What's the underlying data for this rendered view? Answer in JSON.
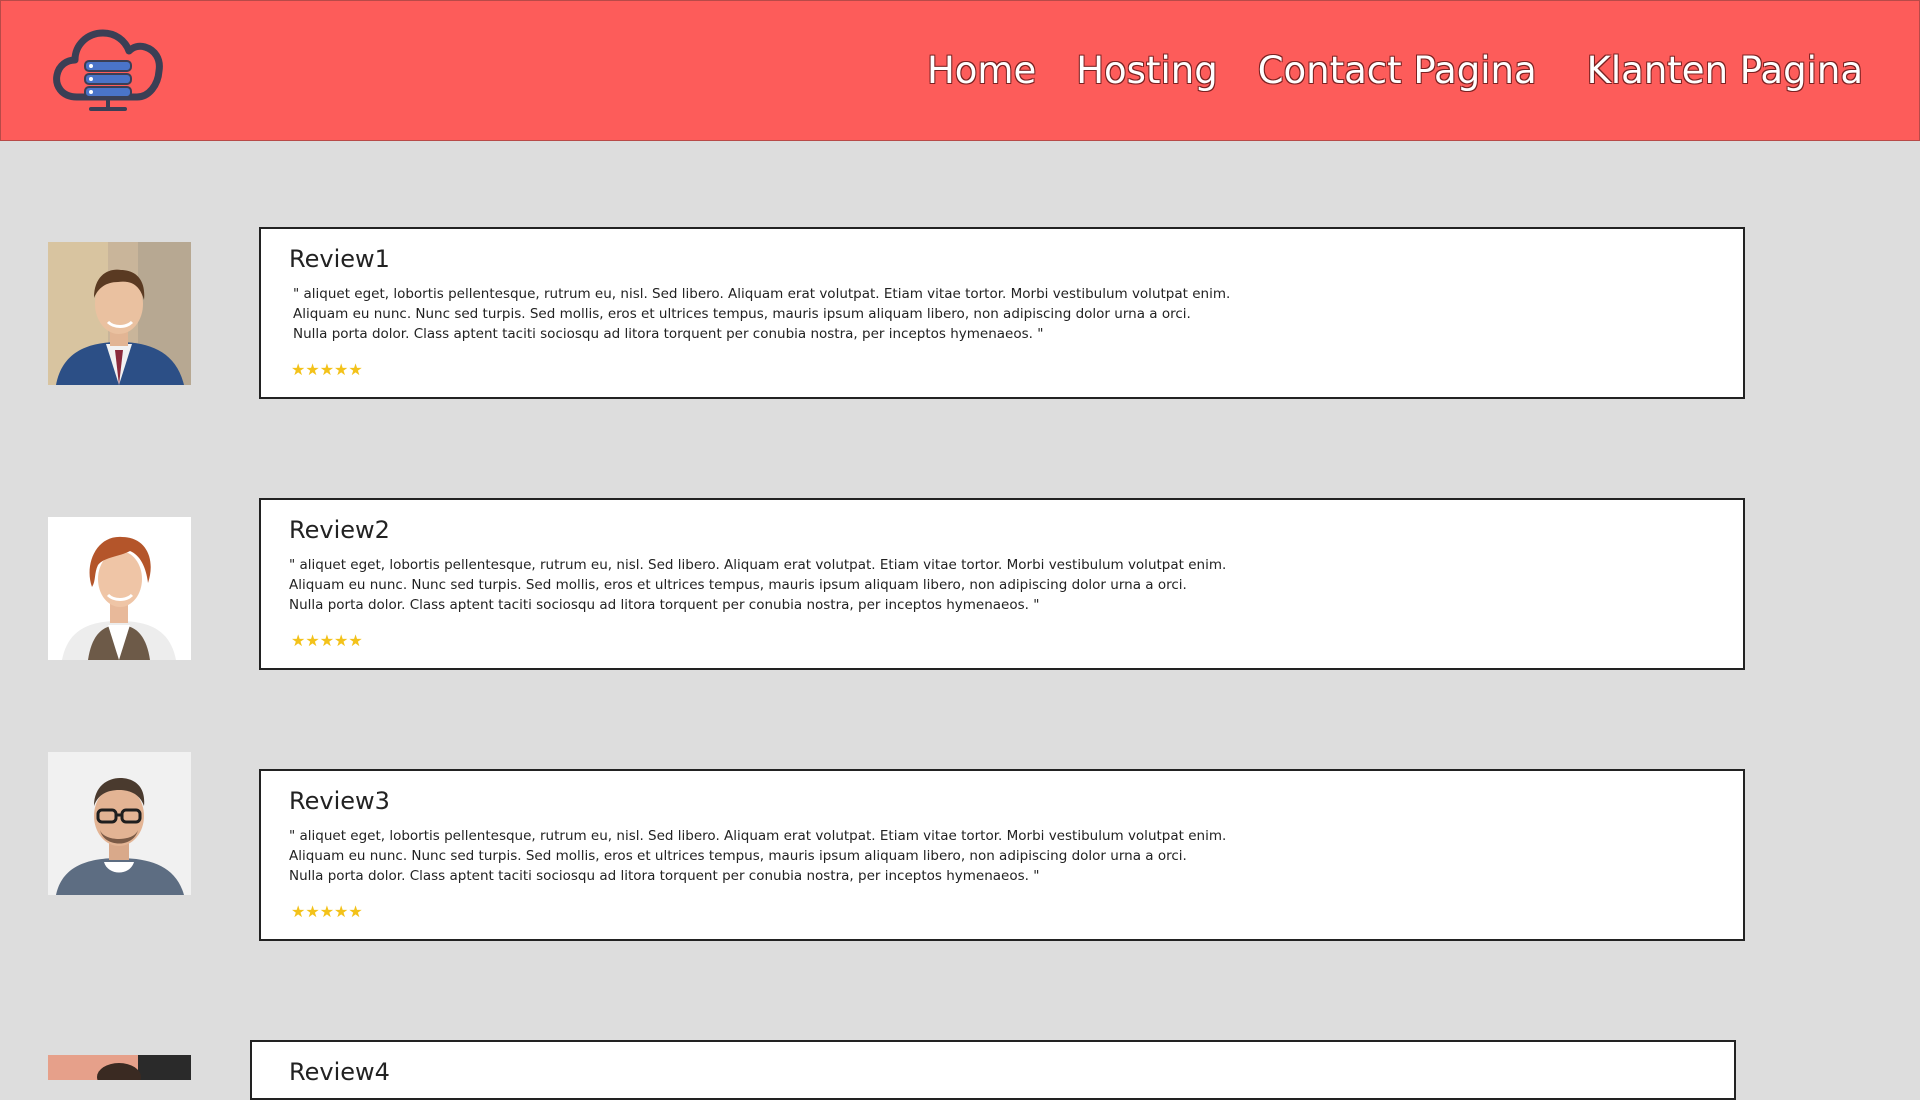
{
  "header": {
    "logo_icon": "cloud-server-icon",
    "nav": [
      {
        "label": "Home"
      },
      {
        "label": "Hosting"
      },
      {
        "label": "Contact Pagina"
      },
      {
        "label": "Klanten Pagina"
      }
    ]
  },
  "colors": {
    "header_bg": "#fd5c5a",
    "page_bg": "#dddddd",
    "star": "#f3c21a"
  },
  "reviews": [
    {
      "title": "Review1",
      "lines": [
        "\" aliquet eget, lobortis pellentesque, rutrum eu, nisl. Sed libero. Aliquam erat volutpat. Etiam vitae tortor. Morbi vestibulum volutpat enim.",
        "Aliquam eu nunc. Nunc sed turpis. Sed mollis, eros et ultrices tempus, mauris ipsum aliquam libero, non adipiscing dolor urna a orci.",
        "Nulla porta dolor. Class aptent taciti sociosqu ad litora torquent per conubia nostra, per inceptos hymenaeos. \""
      ],
      "stars": "★★★★★",
      "rating": 5
    },
    {
      "title": "Review2",
      "lines": [
        "\" aliquet eget, lobortis pellentesque, rutrum eu, nisl. Sed libero. Aliquam erat volutpat. Etiam vitae tortor. Morbi vestibulum volutpat enim.",
        "Aliquam eu nunc. Nunc sed turpis. Sed mollis, eros et ultrices tempus, mauris ipsum aliquam libero, non adipiscing dolor urna a orci.",
        "Nulla porta dolor. Class aptent taciti sociosqu ad litora torquent per conubia nostra, per inceptos hymenaeos. \""
      ],
      "stars": "★★★★★",
      "rating": 5
    },
    {
      "title": "Review3",
      "lines": [
        "\" aliquet eget, lobortis pellentesque, rutrum eu, nisl. Sed libero. Aliquam erat volutpat. Etiam vitae tortor. Morbi vestibulum volutpat enim.",
        "Aliquam eu nunc. Nunc sed turpis. Sed mollis, eros et ultrices tempus, mauris ipsum aliquam libero, non adipiscing dolor urna a orci.",
        "Nulla porta dolor. Class aptent taciti sociosqu ad litora torquent per conubia nostra, per inceptos hymenaeos. \""
      ],
      "stars": "★★★★★",
      "rating": 5
    },
    {
      "title": "Review4"
    }
  ]
}
